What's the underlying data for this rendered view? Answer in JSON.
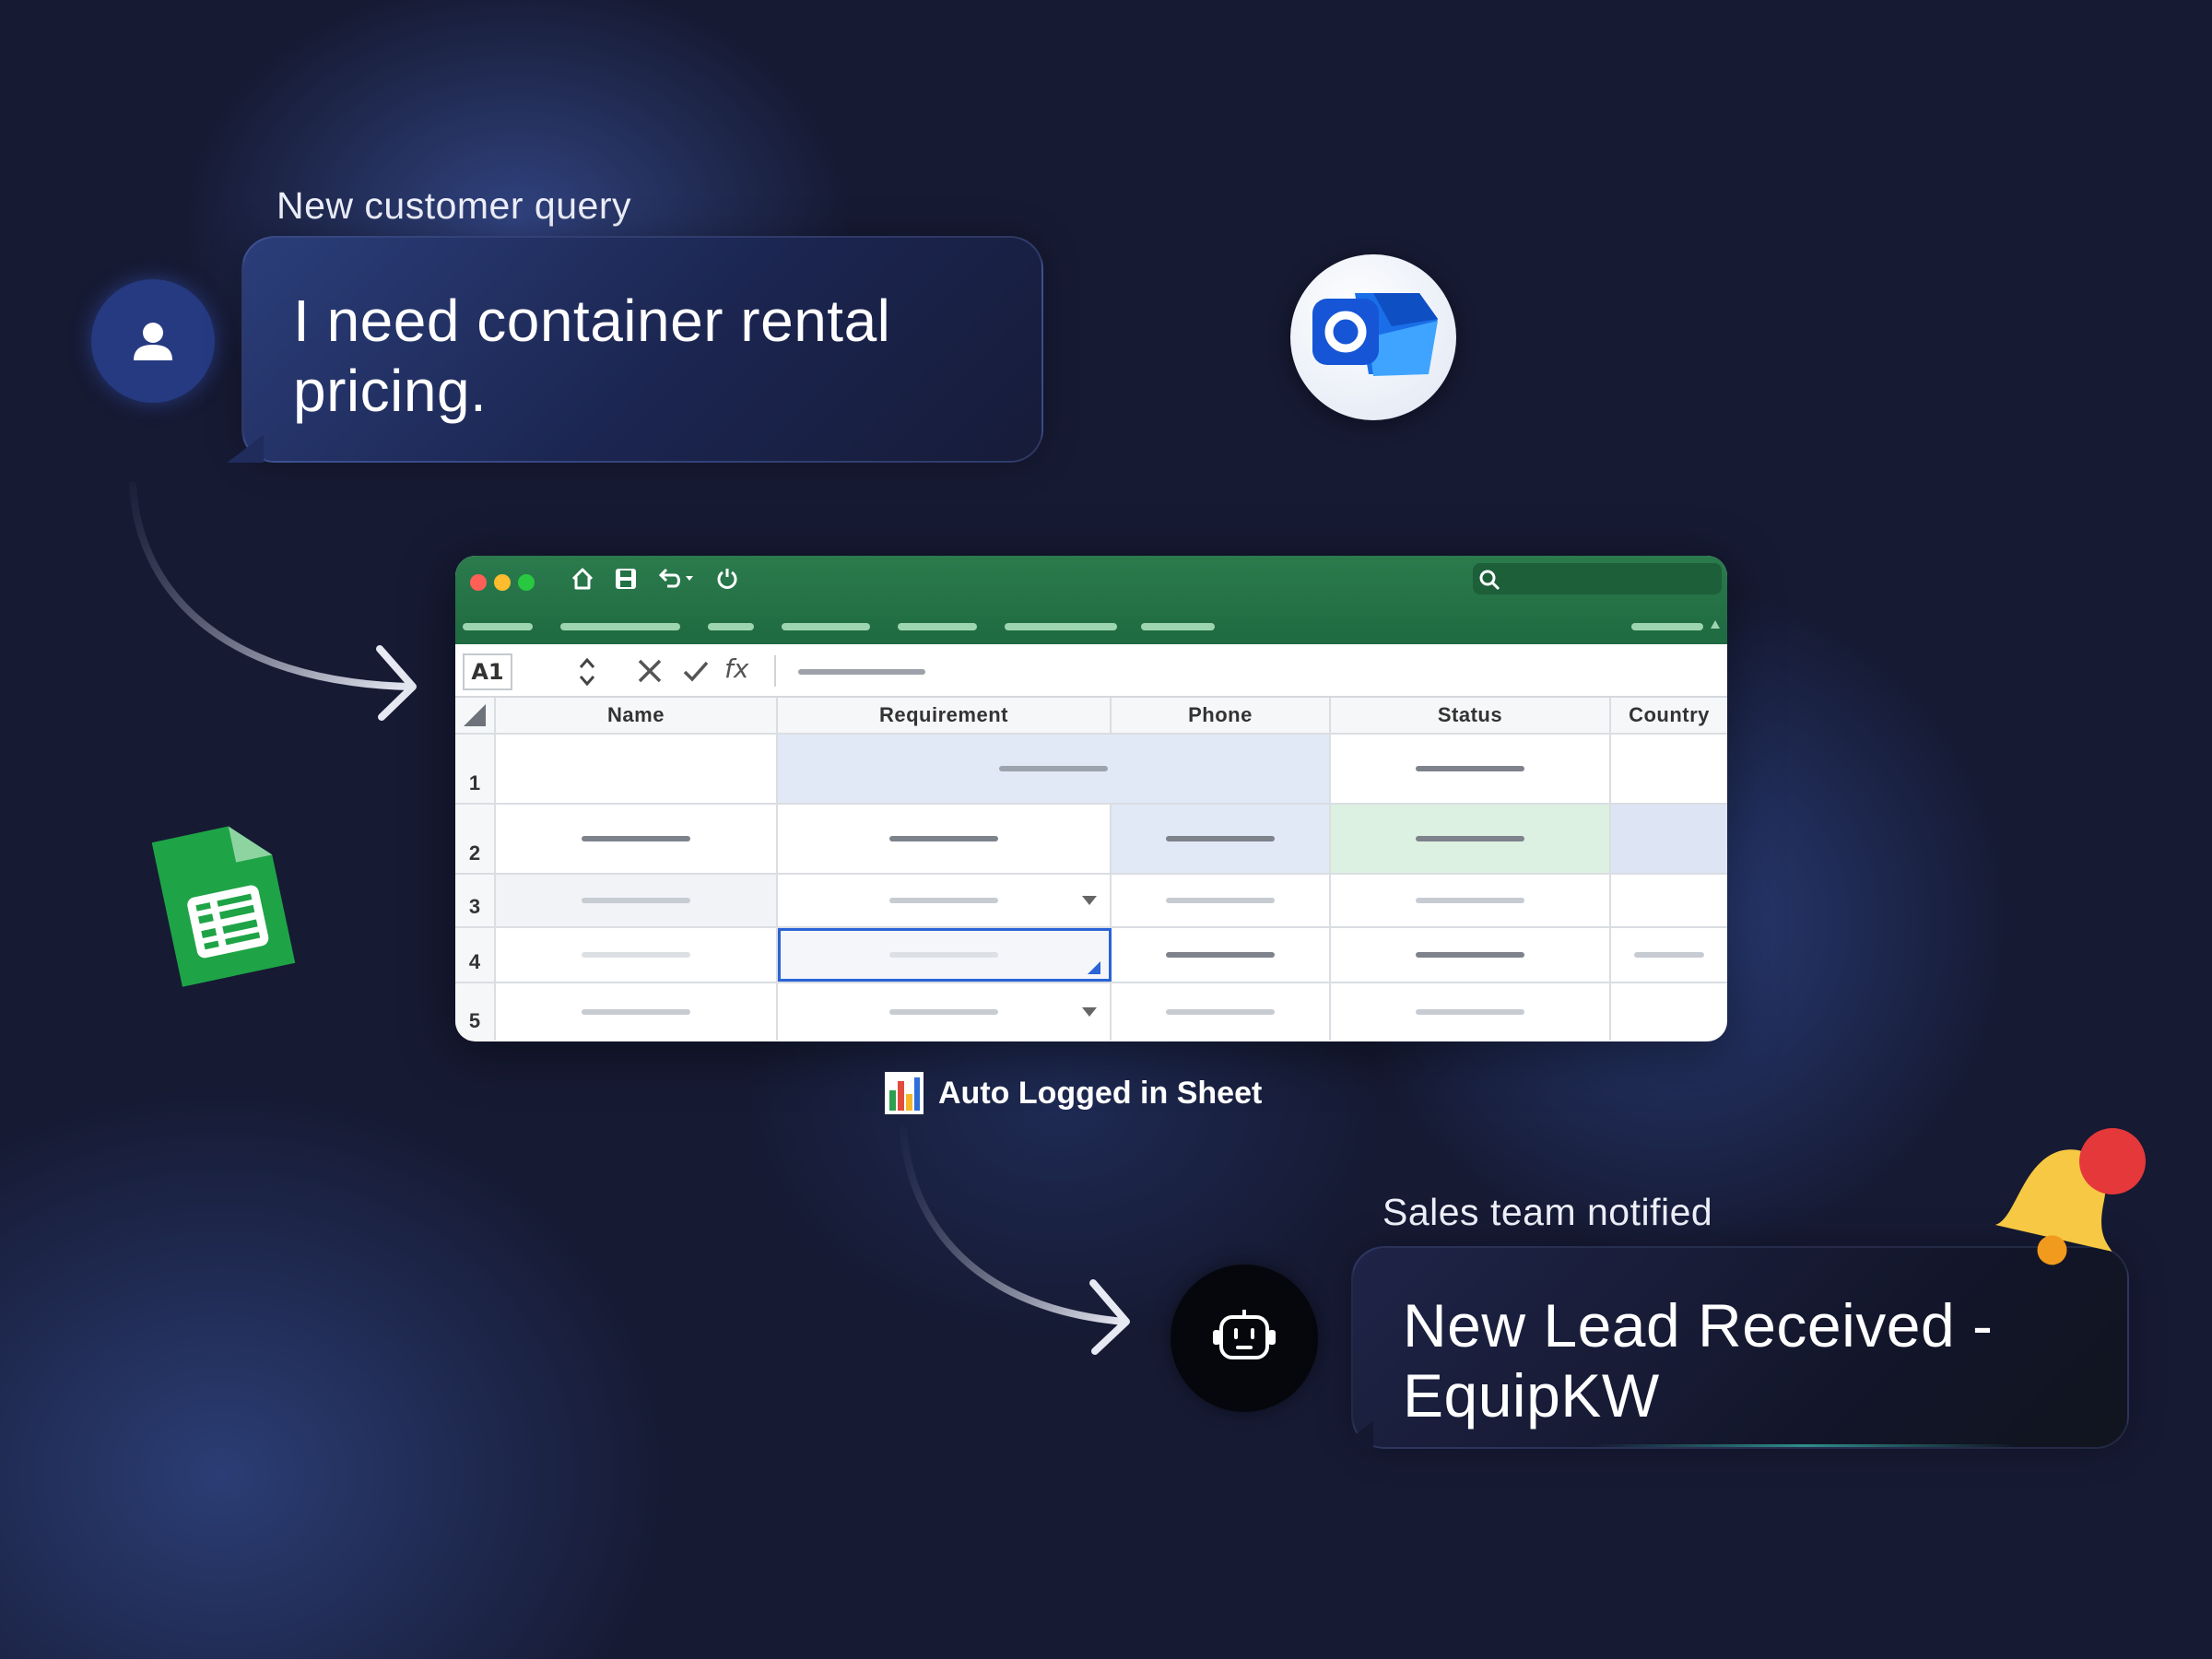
{
  "customer_query": {
    "caption": "New customer query",
    "message": "I need container rental pricing."
  },
  "outlook": {
    "icon": "outlook-app-icon",
    "letter": "O"
  },
  "sheets": {
    "icon": "google-sheets-icon"
  },
  "spreadsheet": {
    "cell_ref": "A1",
    "formula_icon": "fx",
    "columns": [
      "Name",
      "Requirement",
      "Phone",
      "Status",
      "Country"
    ],
    "rows": [
      "1",
      "2",
      "3",
      "4",
      "5"
    ],
    "highlight_colors": {
      "blue": "#e1e9f6",
      "green": "#dcf1e1",
      "selected_border": "#2a64d6"
    }
  },
  "auto_log": {
    "label": "Auto Logged in Sheet",
    "icon": "bar-chart-icon"
  },
  "notification": {
    "caption": "Sales team notified",
    "message": "New Lead Received - EquipKW",
    "robot_icon": "robot-icon",
    "bell_icon": "bell-icon",
    "bell_dot_color": "#e5383b"
  },
  "colors": {
    "background": "#161a33",
    "sheet_green": "#217346",
    "bell_yellow": "#f7c843"
  }
}
